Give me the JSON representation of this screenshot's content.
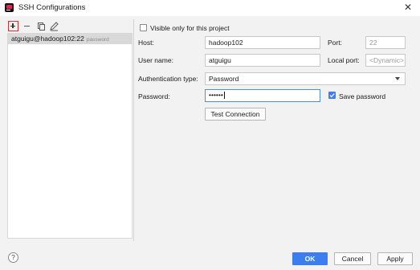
{
  "window": {
    "title": "SSH Configurations",
    "close_glyph": "✕",
    "app_icon": "intellij-icon"
  },
  "toolbar": {
    "add": "add-icon",
    "remove": "minus-icon",
    "copy": "copy-icon",
    "edit": "pencil-icon"
  },
  "configs": {
    "items": [
      {
        "host": "atguigu@hadoop102:22",
        "note": "password"
      }
    ]
  },
  "form": {
    "visible_only_label": "Visible only for this project",
    "host_label": "Host:",
    "host_value": "hadoop102",
    "port_label": "Port:",
    "port_value": "22",
    "username_label": "User name:",
    "username_value": "atguigu",
    "local_port_label": "Local port:",
    "local_port_placeholder": "<Dynamic>",
    "auth_label": "Authentication type:",
    "auth_value": "Password",
    "password_label": "Password:",
    "password_value": "••••••",
    "save_password_label": "Save password",
    "save_password_checked": true,
    "test_connection_label": "Test Connection"
  },
  "footer": {
    "help_label": "?",
    "ok_label": "OK",
    "cancel_label": "Cancel",
    "apply_label": "Apply"
  },
  "colors": {
    "accent": "#3c7ef0",
    "focus_border": "#4a90e2",
    "highlight_add": "#d32f2f"
  }
}
